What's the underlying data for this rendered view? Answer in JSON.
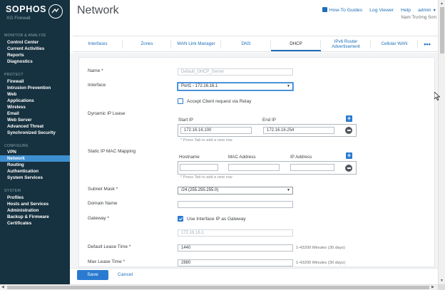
{
  "brand": {
    "name": "SOPHOS",
    "product": "XG Firewall"
  },
  "sidebar": {
    "sections": [
      {
        "title": "MONITOR & ANALYZE",
        "items": [
          "Control Center",
          "Current Activities",
          "Reports",
          "Diagnostics"
        ]
      },
      {
        "title": "PROTECT",
        "items": [
          "Firewall",
          "Intrusion Prevention",
          "Web",
          "Applications",
          "Wireless",
          "Email",
          "Web Server",
          "Advanced Threat",
          "Synchronized Security"
        ]
      },
      {
        "title": "CONFIGURE",
        "items": [
          "VPN",
          "Network",
          "Routing",
          "Authentication",
          "System Services"
        ]
      },
      {
        "title": "SYSTEM",
        "items": [
          "Profiles",
          "Hosts and Services",
          "Administration",
          "Backup & Firmware",
          "Certificates"
        ]
      }
    ],
    "active_item": "Network"
  },
  "header": {
    "title": "Network",
    "links": {
      "how_to": "How-To Guides",
      "log_viewer": "Log Viewer",
      "help": "Help",
      "admin": "admin"
    },
    "user_name": "Nam Trường Sơn"
  },
  "tabs": {
    "items": [
      "Interfaces",
      "Zones",
      "WAN Link Manager",
      "DNS",
      "DHCP",
      "IPv6 Router Advertisement",
      "Cellular WAN"
    ],
    "active": "DHCP",
    "more": "•••"
  },
  "form": {
    "name": {
      "label": "Name *",
      "placeholder": "Default_DHCP_Server"
    },
    "interface": {
      "label": "Interface",
      "value": "Port1 - 172.16.16.1"
    },
    "relay": {
      "label": "Accept Client request via Relay",
      "checked": false
    },
    "dynamic_ip": {
      "label": "Dynamic IP Lease",
      "start_label": "Start IP",
      "end_label": "End IP",
      "start_value": "172.16.16.100",
      "end_value": "172.16.16.254",
      "hint": "* Press Tab to add a new row"
    },
    "static_mac": {
      "label": "Static IP MAC Mapping",
      "hostname_label": "Hostname",
      "mac_label": "MAC Address",
      "ip_label": "IP Address",
      "hint": "* Press Tab to add a new row"
    },
    "subnet": {
      "label": "Subnet Mask *",
      "value": "/24 (255.255.255.0)"
    },
    "domain": {
      "label": "Domain Name",
      "value": ""
    },
    "gateway": {
      "label": "Gateway *",
      "use_interface_label": "Use Interface IP as Gateway",
      "use_interface_checked": true,
      "value": "172.16.16.1"
    },
    "default_lease": {
      "label": "Default Lease Time *",
      "value": "1440",
      "unit": "1-43200 Minutes (30 days)"
    },
    "max_lease": {
      "label": "Max Lease Time *",
      "value": "2880",
      "unit": "1-43200 Minutes (30 days)"
    }
  },
  "footer": {
    "save": "Save",
    "cancel": "Cancel"
  },
  "colors": {
    "sidebar": "#16313f",
    "accent": "#2a7bd0",
    "active_nav": "#3e8fd1"
  }
}
